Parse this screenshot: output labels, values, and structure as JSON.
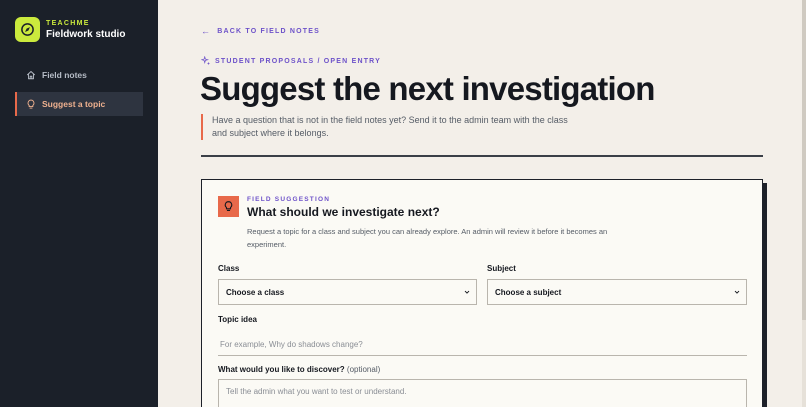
{
  "brand": {
    "kicker": "TEACHME",
    "name": "Fieldwork studio",
    "icon": "compass-icon",
    "accent": "#cbea3d"
  },
  "sidebar": {
    "items": [
      {
        "label": "Field notes",
        "icon": "home-icon",
        "active": false
      },
      {
        "label": "Suggest a topic",
        "icon": "lightbulb-icon",
        "active": true
      }
    ]
  },
  "header": {
    "back_label": "BACK TO FIELD NOTES",
    "eyebrow": "STUDENT PROPOSALS / OPEN ENTRY",
    "title": "Suggest the next investigation",
    "lead": "Have a question that is not in the field notes yet? Send it to the admin team with the class and subject where it belongs."
  },
  "form": {
    "kicker": "FIELD SUGGESTION",
    "title": "What should we investigate next?",
    "description": "Request a topic for a class and subject you can already explore. An admin will review it before it becomes an experiment.",
    "class_label": "Class",
    "class_value": "Choose a class",
    "subject_label": "Subject",
    "subject_value": "Choose a subject",
    "topic_label": "Topic idea",
    "topic_placeholder": "For example, Why do shadows change?",
    "discover_label": "What would you like to discover?",
    "discover_optional": "(optional)",
    "discover_placeholder": "Tell the admin what you want to test or understand."
  },
  "colors": {
    "sidebar_bg": "#1b2029",
    "accent_orange": "#e8694a",
    "accent_purple": "#6d52c9",
    "page_bg": "#f3efe9"
  }
}
